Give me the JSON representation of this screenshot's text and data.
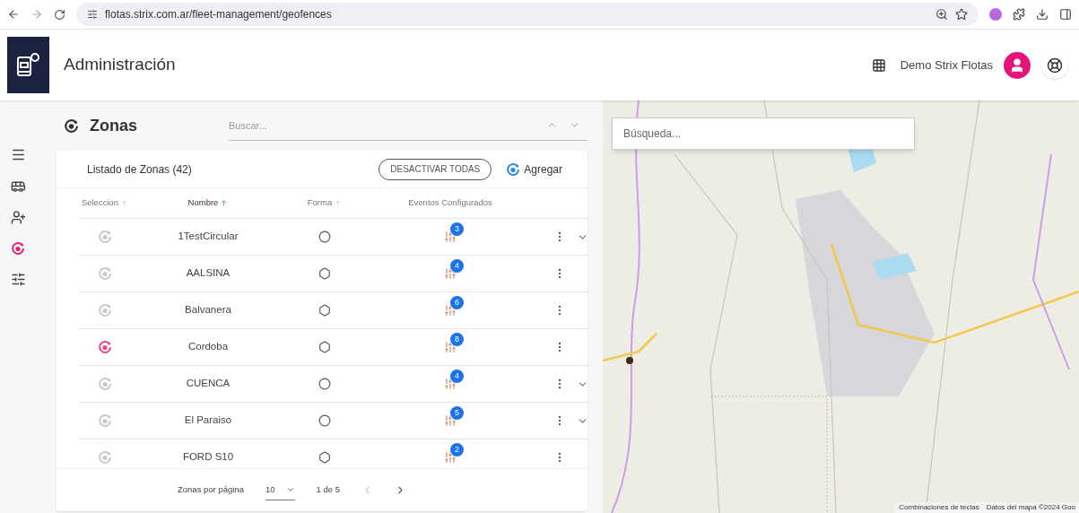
{
  "browser": {
    "url": "flotas.strix.com.ar/fleet-management/geofences"
  },
  "header": {
    "title": "Administración",
    "user_name": "Demo Strix Flotas"
  },
  "sidebar": {
    "items": [
      {
        "kind": "menu",
        "selected": false
      },
      {
        "kind": "vehicles",
        "selected": false
      },
      {
        "kind": "drivers",
        "selected": false
      },
      {
        "kind": "zones",
        "selected": true
      },
      {
        "kind": "settings",
        "selected": false
      }
    ]
  },
  "section": {
    "title": "Zonas",
    "search_placeholder": "Buscar..."
  },
  "card": {
    "title": "Listado de Zonas (42)",
    "deactivate_button": "DESACTIVAR TODAS",
    "add_button": "Agregar"
  },
  "table": {
    "columns": [
      {
        "label": "Seleccion",
        "sortable": true,
        "selected": false
      },
      {
        "label": "Nombre",
        "sortable": true,
        "selected": true
      },
      {
        "label": "Forma",
        "sortable": true,
        "selected": false
      },
      {
        "label": "Eventos Configurados",
        "sortable": false,
        "selected": false
      }
    ],
    "rows": [
      {
        "name": "1TestCircular",
        "kind": "circle",
        "events": "3",
        "selected": false,
        "expandable": true
      },
      {
        "name": "AALSINA",
        "kind": "polygon",
        "events": "4",
        "selected": false,
        "expandable": false
      },
      {
        "name": "Balvanera",
        "kind": "polygon",
        "events": "6",
        "selected": false,
        "expandable": false
      },
      {
        "name": "Cordoba",
        "kind": "polygon",
        "events": "8",
        "selected": true,
        "expandable": false
      },
      {
        "name": "CUENCA",
        "kind": "circle",
        "events": "4",
        "selected": false,
        "expandable": true
      },
      {
        "name": "El Paraiso",
        "kind": "circle",
        "events": "5",
        "selected": false,
        "expandable": true
      },
      {
        "name": "FORD S10",
        "kind": "polygon",
        "events": "2",
        "selected": false,
        "expandable": false
      }
    ]
  },
  "pagination": {
    "label": "Zonas por página",
    "page_size": "10",
    "range": "1 de 5"
  },
  "map": {
    "kind": "picture",
    "search_placeholder": "Búsqueda...",
    "shortcuts": "Combinaciones de teclas",
    "attribution": "Datos del mapa ©2024 Goo"
  }
}
